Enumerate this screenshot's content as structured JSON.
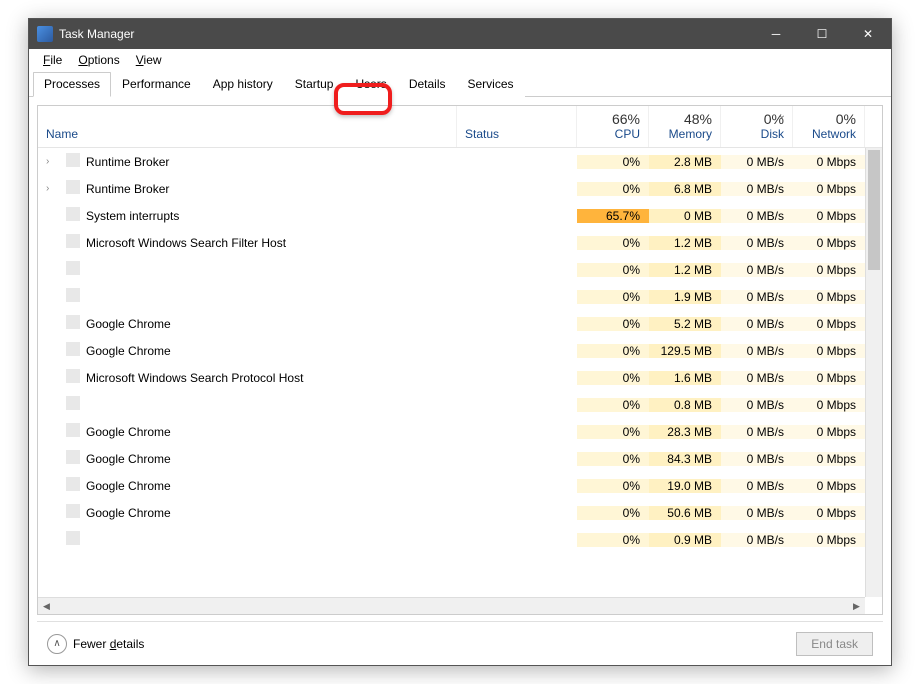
{
  "title": "Task Manager",
  "menu": {
    "file": "File",
    "options": "Options",
    "view": "View"
  },
  "tabs": {
    "processes": "Processes",
    "performance": "Performance",
    "app_history": "App history",
    "startup": "Startup",
    "users": "Users",
    "details": "Details",
    "services": "Services"
  },
  "columns": {
    "name": "Name",
    "status": "Status",
    "cpu_pct": "66%",
    "cpu": "CPU",
    "mem_pct": "48%",
    "mem": "Memory",
    "disk_pct": "0%",
    "disk": "Disk",
    "net_pct": "0%",
    "net": "Network"
  },
  "rows": [
    {
      "expand": "›",
      "name": "Runtime Broker",
      "cpu": "0%",
      "cpu_cls": "cpu",
      "mem": "2.8 MB",
      "disk": "0 MB/s",
      "net": "0 Mbps"
    },
    {
      "expand": "›",
      "name": "Runtime Broker",
      "cpu": "0%",
      "cpu_cls": "cpu",
      "mem": "6.8 MB",
      "disk": "0 MB/s",
      "net": "0 Mbps"
    },
    {
      "expand": "",
      "name": "System interrupts",
      "cpu": "65.7%",
      "cpu_cls": "hot",
      "mem": "0 MB",
      "disk": "0 MB/s",
      "net": "0 Mbps"
    },
    {
      "expand": "",
      "name": "Microsoft Windows Search Filter Host",
      "cpu": "0%",
      "cpu_cls": "cpu",
      "mem": "1.2 MB",
      "disk": "0 MB/s",
      "net": "0 Mbps"
    },
    {
      "expand": "",
      "name": "",
      "cpu": "0%",
      "cpu_cls": "cpu",
      "mem": "1.2 MB",
      "disk": "0 MB/s",
      "net": "0 Mbps"
    },
    {
      "expand": "",
      "name": "",
      "cpu": "0%",
      "cpu_cls": "cpu",
      "mem": "1.9 MB",
      "disk": "0 MB/s",
      "net": "0 Mbps"
    },
    {
      "expand": "",
      "name": "Google Chrome",
      "cpu": "0%",
      "cpu_cls": "cpu",
      "mem": "5.2 MB",
      "disk": "0 MB/s",
      "net": "0 Mbps"
    },
    {
      "expand": "",
      "name": "Google Chrome",
      "cpu": "0%",
      "cpu_cls": "cpu",
      "mem": "129.5 MB",
      "disk": "0 MB/s",
      "net": "0 Mbps"
    },
    {
      "expand": "",
      "name": "Microsoft Windows Search Protocol Host",
      "cpu": "0%",
      "cpu_cls": "cpu",
      "mem": "1.6 MB",
      "disk": "0 MB/s",
      "net": "0 Mbps"
    },
    {
      "expand": "",
      "name": "",
      "cpu": "0%",
      "cpu_cls": "cpu",
      "mem": "0.8 MB",
      "disk": "0 MB/s",
      "net": "0 Mbps"
    },
    {
      "expand": "",
      "name": "Google Chrome",
      "cpu": "0%",
      "cpu_cls": "cpu",
      "mem": "28.3 MB",
      "disk": "0 MB/s",
      "net": "0 Mbps"
    },
    {
      "expand": "",
      "name": "Google Chrome",
      "cpu": "0%",
      "cpu_cls": "cpu",
      "mem": "84.3 MB",
      "disk": "0 MB/s",
      "net": "0 Mbps"
    },
    {
      "expand": "",
      "name": "Google Chrome",
      "cpu": "0%",
      "cpu_cls": "cpu",
      "mem": "19.0 MB",
      "disk": "0 MB/s",
      "net": "0 Mbps"
    },
    {
      "expand": "",
      "name": "Google Chrome",
      "cpu": "0%",
      "cpu_cls": "cpu",
      "mem": "50.6 MB",
      "disk": "0 MB/s",
      "net": "0 Mbps"
    },
    {
      "expand": "",
      "name": "",
      "cpu": "0%",
      "cpu_cls": "cpu",
      "mem": "0.9 MB",
      "disk": "0 MB/s",
      "net": "0 Mbps"
    }
  ],
  "footer": {
    "fewer": "Fewer details",
    "end_task": "End task"
  }
}
